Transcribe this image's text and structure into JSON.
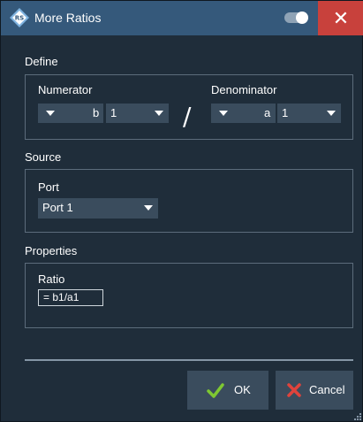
{
  "window": {
    "title": "More Ratios",
    "close_label": "✕"
  },
  "define": {
    "section_label": "Define",
    "numerator": {
      "label": "Numerator",
      "wave": "b",
      "port": "1"
    },
    "separator": "/",
    "denominator": {
      "label": "Denominator",
      "wave": "a",
      "port": "1"
    }
  },
  "source": {
    "section_label": "Source",
    "port_label": "Port",
    "port_value": "Port 1"
  },
  "properties": {
    "section_label": "Properties",
    "ratio_label": "Ratio",
    "ratio_value": "= b1/a1"
  },
  "buttons": {
    "ok_label": "OK",
    "cancel_label": "Cancel"
  },
  "colors": {
    "title_bar": "#35597b",
    "body": "#1f2d3a",
    "close": "#c8413c",
    "ok_check": "#7ec832",
    "cancel_x": "#e0433c"
  },
  "icons": {
    "logo": "rohde-schwarz-logo-icon",
    "toggle": "toggle-switch-icon",
    "close": "close-icon",
    "dropdown": "chevron-down-icon",
    "ok": "checkmark-icon",
    "cancel": "x-mark-icon",
    "resize": "resize-grip-icon"
  }
}
